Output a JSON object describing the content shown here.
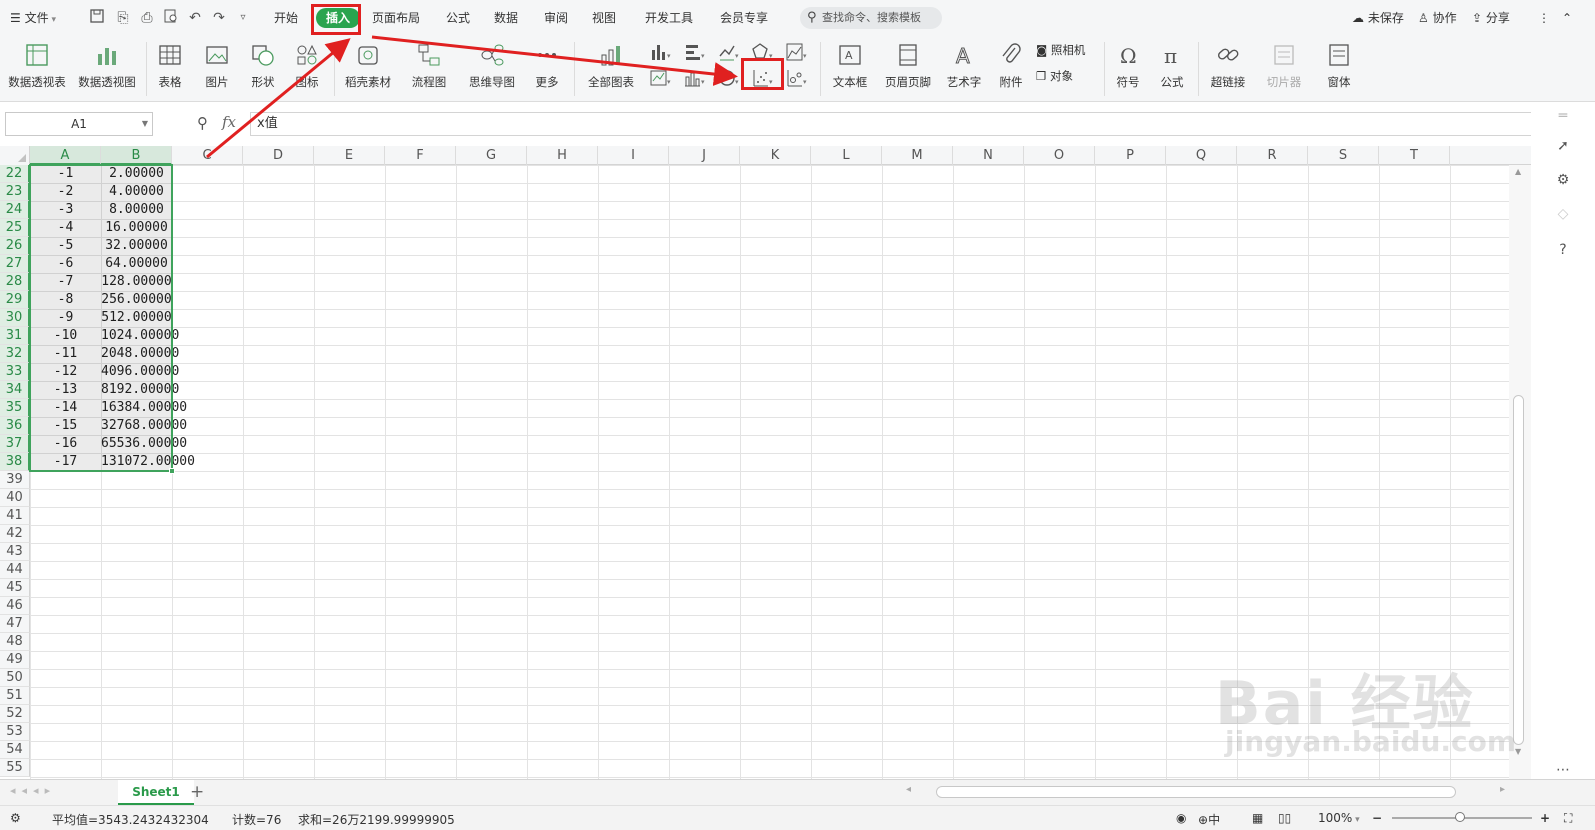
{
  "menu": {
    "file": "文件",
    "tabs": [
      "开始",
      "插入",
      "页面布局",
      "公式",
      "数据",
      "审阅",
      "视图",
      "开发工具",
      "会员专享"
    ],
    "active_tab": "插入",
    "search_placeholder": "查找命令、搜索模板",
    "right": {
      "unsaved": "未保存",
      "collab": "协作",
      "share": "分享"
    }
  },
  "ribbon": {
    "pivot_table": "数据透视表",
    "pivot_chart": "数据透视图",
    "table": "表格",
    "picture": "图片",
    "shape": "形状",
    "icon": "图标",
    "material": "稻壳素材",
    "flowchart": "流程图",
    "mindmap": "思维导图",
    "more": "更多",
    "all_charts": "全部图表",
    "textbox": "文本框",
    "header_footer": "页眉页脚",
    "wordart": "艺术字",
    "attachment": "附件",
    "camera": "照相机",
    "object": "对象",
    "symbol": "符号",
    "formula": "公式",
    "hyperlink": "超链接",
    "slicer": "切片器",
    "window": "窗体"
  },
  "formula_bar": {
    "name_box": "A1",
    "fx": "fx",
    "content": "x值"
  },
  "columns": [
    "A",
    "B",
    "C",
    "D",
    "E",
    "F",
    "G",
    "H",
    "I",
    "J",
    "K",
    "L",
    "M",
    "N",
    "O",
    "P",
    "Q",
    "R",
    "S",
    "T"
  ],
  "selected_columns": [
    "A",
    "B"
  ],
  "rows": [
    "22",
    "23",
    "24",
    "25",
    "26",
    "27",
    "28",
    "29",
    "30",
    "31",
    "32",
    "33",
    "34",
    "35",
    "36",
    "37",
    "38",
    "39",
    "40",
    "41",
    "42",
    "43",
    "44",
    "45",
    "46",
    "47",
    "48",
    "49",
    "50",
    "51",
    "52",
    "53",
    "54",
    "55"
  ],
  "data_rows": [
    {
      "a": "-1",
      "b": "2.00000"
    },
    {
      "a": "-2",
      "b": "4.00000"
    },
    {
      "a": "-3",
      "b": "8.00000"
    },
    {
      "a": "-4",
      "b": "16.00000"
    },
    {
      "a": "-5",
      "b": "32.00000"
    },
    {
      "a": "-6",
      "b": "64.00000"
    },
    {
      "a": "-7",
      "b": "128.00000"
    },
    {
      "a": "-8",
      "b": "256.00000"
    },
    {
      "a": "-9",
      "b": "512.00000"
    },
    {
      "a": "-10",
      "b": "1024.00000"
    },
    {
      "a": "-11",
      "b": "2048.00000"
    },
    {
      "a": "-12",
      "b": "4096.00000"
    },
    {
      "a": "-13",
      "b": "8192.00000"
    },
    {
      "a": "-14",
      "b": "16384.00000"
    },
    {
      "a": "-15",
      "b": "32768.00000"
    },
    {
      "a": "-16",
      "b": "65536.00000"
    },
    {
      "a": "-17",
      "b": "131072.00000"
    }
  ],
  "sheet_tab": "Sheet1",
  "status": {
    "average": "平均值=3543.2432432304",
    "count": "计数=76",
    "sum": "求和=26万2199.99999905",
    "lang": "中",
    "zoom": "100%"
  },
  "watermark": {
    "main": "Bai 经验",
    "sub": "jingyan.baidu.com"
  },
  "colors": {
    "accent": "#2aa44f",
    "selection": "#3fa35c",
    "annotation": "#e02020"
  }
}
